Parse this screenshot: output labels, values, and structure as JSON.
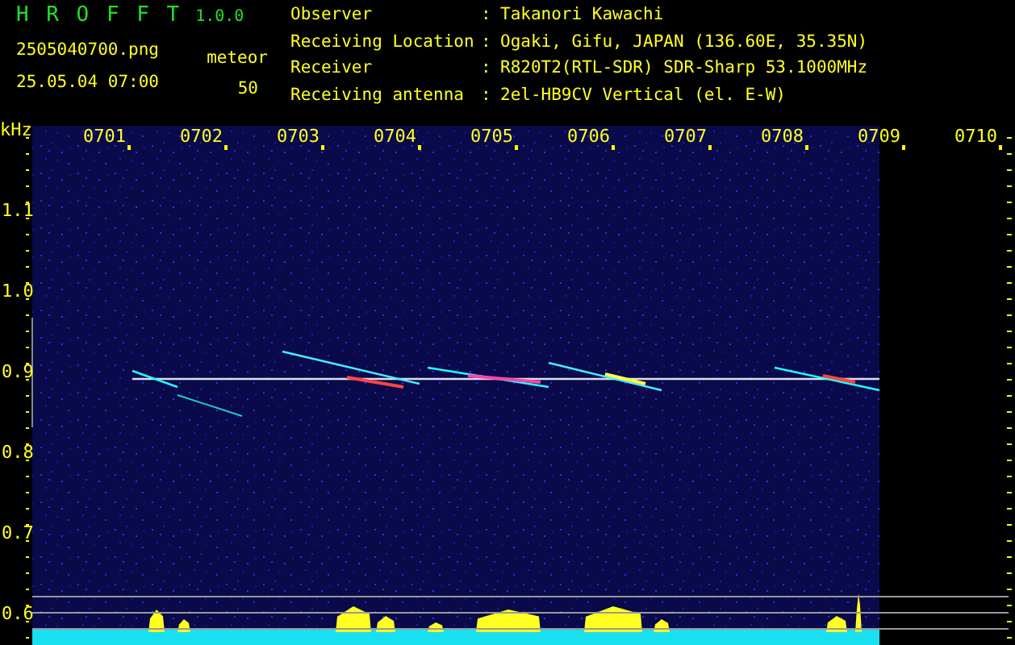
{
  "app": {
    "title": "H R O F F T",
    "version": "1.0.0",
    "filename": "2505040700.png",
    "timestamp": "25.05.04 07:00",
    "mode_label": "meteor",
    "count": "50"
  },
  "info": [
    {
      "label": "Observer",
      "sep": ":",
      "value": "Takanori Kawachi"
    },
    {
      "label": "Receiving Location",
      "sep": ":",
      "value": "Ogaki, Gifu, JAPAN (136.60E, 35.35N)"
    },
    {
      "label": "Receiver",
      "sep": ":",
      "value": "R820T2(RTL-SDR) SDR-Sharp 53.1000MHz"
    },
    {
      "label": "Receiving antenna",
      "sep": ":",
      "value": "2el-HB9CV Vertical (el. E-W)"
    }
  ],
  "plot": {
    "y_unit": "kHz",
    "time_ticks": [
      "0701",
      "0702",
      "0703",
      "0704",
      "0705",
      "0706",
      "0707",
      "0708",
      "0709",
      "0710"
    ],
    "freq_ticks": [
      "1.1",
      "1.0",
      "0.9",
      "0.8",
      "0.7",
      "0.6"
    ]
  }
}
